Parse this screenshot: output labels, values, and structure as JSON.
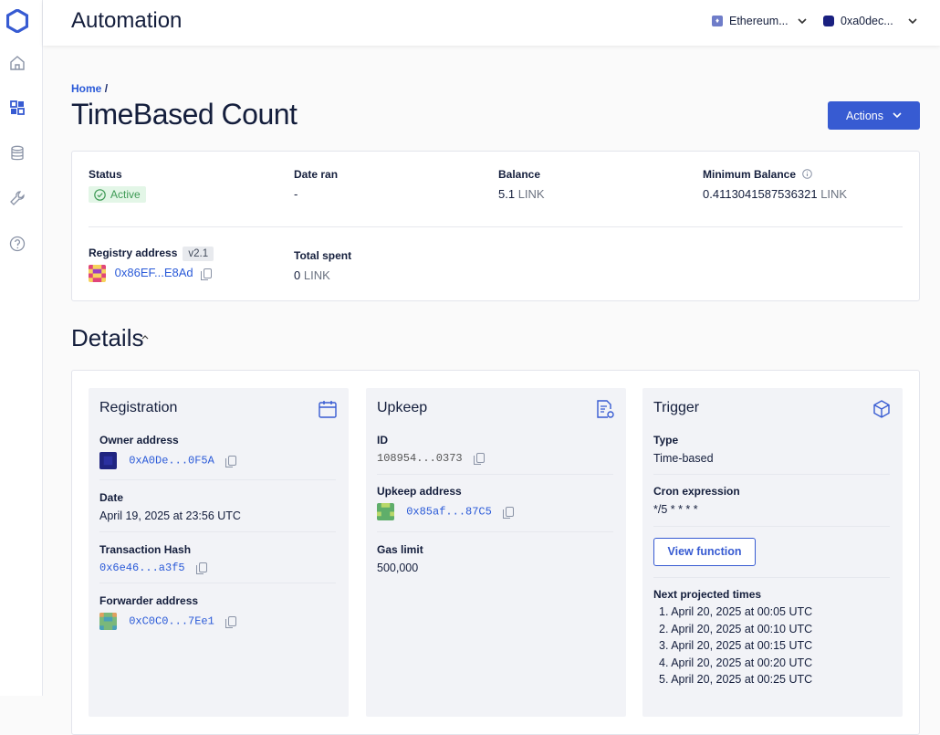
{
  "app": {
    "title": "Automation"
  },
  "topbar": {
    "network": "Ethereum...",
    "wallet": "0xa0dec..."
  },
  "breadcrumb": {
    "home": "Home",
    "sep": "/"
  },
  "page": {
    "title": "TimeBased Count",
    "actions_label": "Actions"
  },
  "summary": {
    "status_label": "Status",
    "status_value": "Active",
    "date_ran_label": "Date ran",
    "date_ran_value": "-",
    "balance_label": "Balance",
    "balance_value": "5.1",
    "balance_unit": "LINK",
    "min_balance_label": "Minimum Balance",
    "min_balance_value": "0.4113041587536321",
    "min_balance_unit": "LINK",
    "registry_label": "Registry address",
    "registry_version": "v2.1",
    "registry_address": "0x86EF...E8Ad",
    "total_spent_label": "Total spent",
    "total_spent_value": "0",
    "total_spent_unit": "LINK"
  },
  "details": {
    "title": "Details",
    "registration": {
      "title": "Registration",
      "owner_label": "Owner address",
      "owner_value": "0xA0De...0F5A",
      "date_label": "Date",
      "date_value": "April 19, 2025 at 23:56 UTC",
      "tx_label": "Transaction Hash",
      "tx_value": "0x6e46...a3f5",
      "forwarder_label": "Forwarder address",
      "forwarder_value": "0xC0C0...7Ee1"
    },
    "upkeep": {
      "title": "Upkeep",
      "id_label": "ID",
      "id_value": "108954...0373",
      "address_label": "Upkeep address",
      "address_value": "0x85af...87C5",
      "gas_label": "Gas limit",
      "gas_value": "500,000"
    },
    "trigger": {
      "title": "Trigger",
      "type_label": "Type",
      "type_value": "Time-based",
      "cron_label": "Cron expression",
      "cron_value": "*/5 * * * *",
      "view_function": "View function",
      "next_label": "Next projected times",
      "next_times": [
        "1. April 20, 2025 at 00:05 UTC",
        "2. April 20, 2025 at 00:10 UTC",
        "3. April 20, 2025 at 00:15 UTC",
        "4. April 20, 2025 at 00:20 UTC",
        "5. April 20, 2025 at 00:25 UTC"
      ]
    }
  },
  "colors": {
    "accent": "#375bd2",
    "link": "#2a5ad8",
    "active_bg": "#e3f6e7",
    "active_fg": "#3e9a55"
  },
  "icons": [
    "chainlink-logo-icon",
    "home-icon",
    "dashboard-icon",
    "database-icon",
    "wrench-icon",
    "help-icon",
    "chevron-down-icon",
    "check-circle-icon",
    "info-icon",
    "copy-icon",
    "calendar-icon",
    "document-settings-icon",
    "cube-icon"
  ]
}
